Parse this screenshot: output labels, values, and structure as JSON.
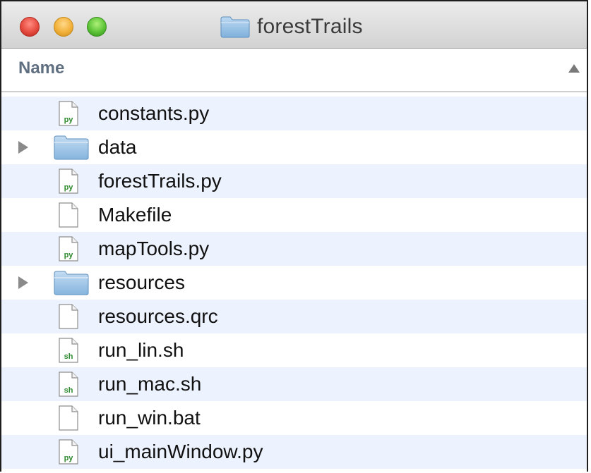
{
  "window": {
    "title": "forestTrails",
    "title_icon": "folder-icon"
  },
  "header": {
    "column_name": "Name",
    "sort": "ascending"
  },
  "files": [
    {
      "name": "constants.py",
      "kind": "python",
      "icon": "python-file-icon",
      "badge": "py"
    },
    {
      "name": "data",
      "kind": "folder",
      "icon": "folder-icon"
    },
    {
      "name": "forestTrails.py",
      "kind": "python",
      "icon": "python-file-icon",
      "badge": "py"
    },
    {
      "name": "Makefile",
      "kind": "plain",
      "icon": "document-icon"
    },
    {
      "name": "mapTools.py",
      "kind": "python",
      "icon": "python-file-icon",
      "badge": "py"
    },
    {
      "name": "resources",
      "kind": "folder",
      "icon": "folder-icon"
    },
    {
      "name": "resources.qrc",
      "kind": "plain",
      "icon": "document-icon"
    },
    {
      "name": "run_lin.sh",
      "kind": "shell",
      "icon": "shell-script-icon",
      "badge": "sh"
    },
    {
      "name": "run_mac.sh",
      "kind": "shell",
      "icon": "shell-script-icon",
      "badge": "sh"
    },
    {
      "name": "run_win.bat",
      "kind": "plain",
      "icon": "document-icon"
    },
    {
      "name": "ui_mainWindow.py",
      "kind": "python",
      "icon": "python-file-icon",
      "badge": "py"
    }
  ],
  "colors": {
    "row_alternate": "#edf3fe",
    "header_text": "#5f6f80",
    "badge_green": "#2e8a2e",
    "folder_blue": "#9cc3e6"
  }
}
